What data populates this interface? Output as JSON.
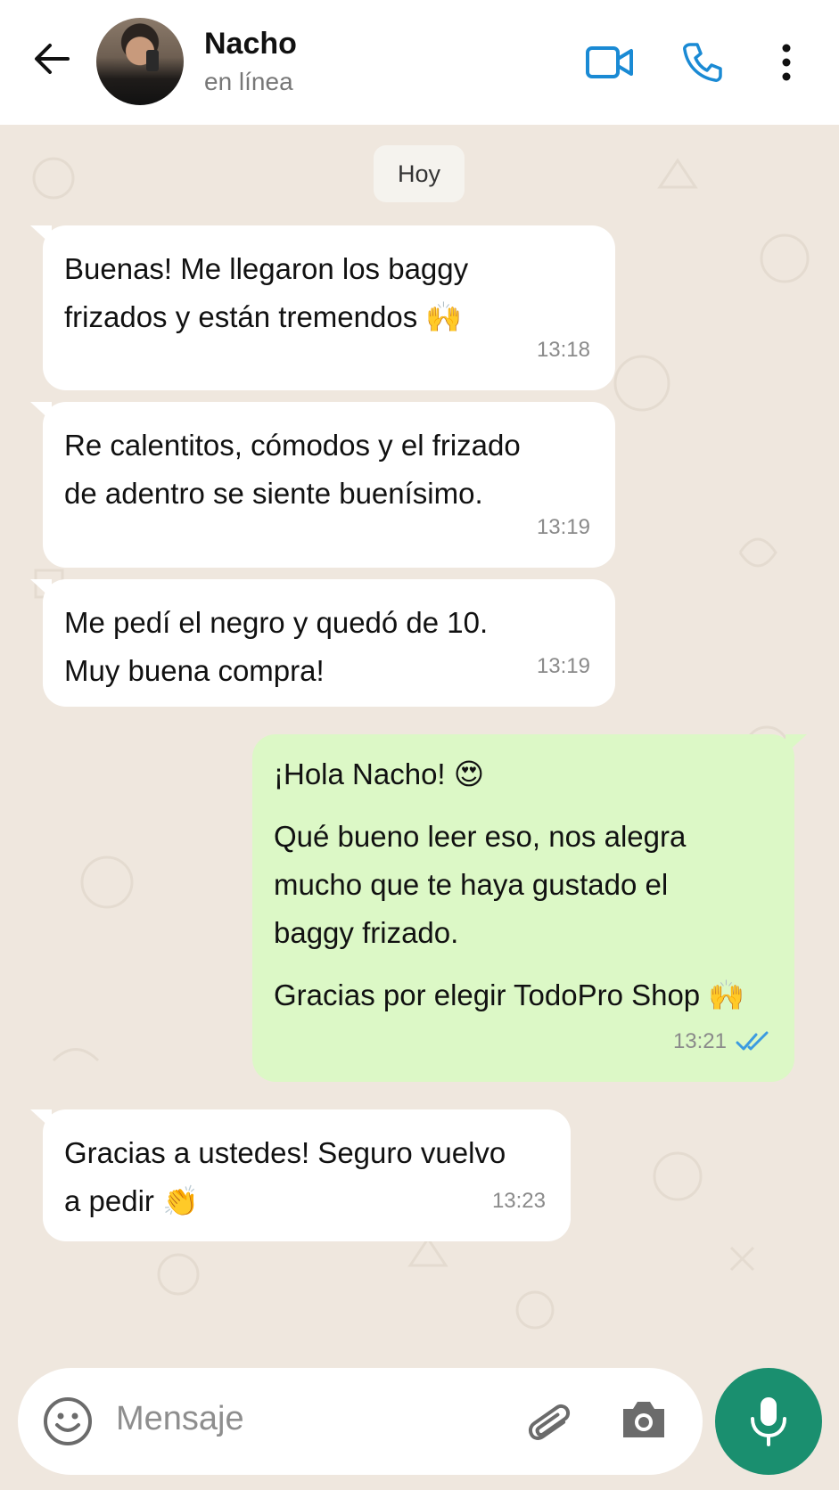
{
  "header": {
    "contact_name": "Nacho",
    "status": "en línea"
  },
  "chat": {
    "day_label": "Hoy",
    "messages": [
      {
        "direction": "in",
        "paragraphs": [
          "Buenas! Me llegaron los baggy\nfrizados y están tremendos 🙌"
        ],
        "time": "13:18"
      },
      {
        "direction": "in",
        "paragraphs": [
          "Re calentitos, cómodos y el frizado\nde adentro se siente buenísimo."
        ],
        "time": "13:19"
      },
      {
        "direction": "in",
        "paragraphs": [
          "Me pedí el negro y quedó de 10.\nMuy buena compra!"
        ],
        "time": "13:19"
      },
      {
        "direction": "out",
        "paragraphs": [
          "¡Hola Nacho! 😍",
          "Qué bueno leer eso, nos alegra\nmucho que te haya gustado el\nbaggy frizado.",
          "Gracias por elegir TodoPro Shop 🙌"
        ],
        "time": "13:21",
        "status": "read"
      },
      {
        "direction": "in",
        "paragraphs": [
          "Gracias a ustedes! Seguro vuelvo\na pedir 👏"
        ],
        "time": "13:23"
      }
    ]
  },
  "input": {
    "placeholder": "Mensaje"
  },
  "colors": {
    "accent": "#1a8ad4",
    "mic_button": "#1a8f6f",
    "outgoing_bubble": "#dcf8c6",
    "chat_background": "#efe7de",
    "read_ticks": "#3b9be0"
  },
  "icons": {
    "back": "arrow-left-icon",
    "video": "video-camera-icon",
    "call": "phone-icon",
    "menu": "more-vertical-icon",
    "emoji": "smiley-icon",
    "attach": "paperclip-icon",
    "camera": "camera-icon",
    "mic": "microphone-icon",
    "ticks": "double-check-icon"
  }
}
